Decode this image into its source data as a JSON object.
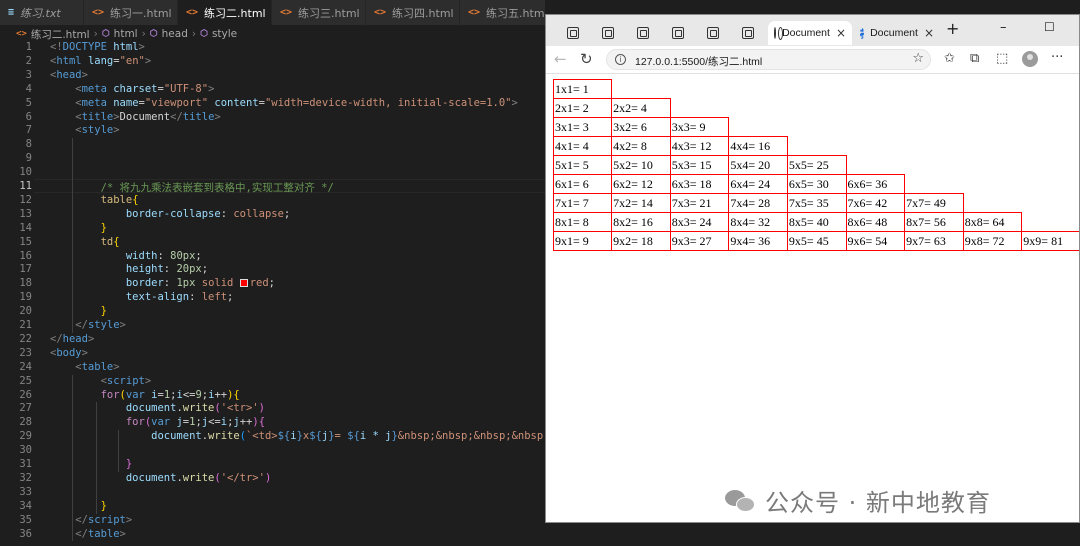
{
  "editor": {
    "tabs": [
      {
        "label": "练习.txt",
        "icon": "text-file-icon"
      },
      {
        "label": "练习一.html",
        "icon": "html-file-icon"
      },
      {
        "label": "练习二.html",
        "icon": "html-file-icon",
        "active": true
      },
      {
        "label": "练习三.html",
        "icon": "html-file-icon"
      },
      {
        "label": "练习四.html",
        "icon": "html-file-icon"
      },
      {
        "label": "练习五.html",
        "icon": "html-file-icon"
      }
    ],
    "close_glyph": "×",
    "breadcrumb": [
      "练习二.html",
      "html",
      "head",
      "style"
    ],
    "current_line": 11,
    "lines": [
      {
        "n": 1,
        "tokens": [
          {
            "t": "<!",
            "c": "#808080"
          },
          {
            "t": "DOCTYPE",
            "c": "#569cd6"
          },
          {
            "t": " html",
            "c": "#9cdcfe"
          },
          {
            "t": ">",
            "c": "#808080"
          }
        ]
      },
      {
        "n": 2,
        "tokens": [
          {
            "t": "<",
            "c": "#808080"
          },
          {
            "t": "html",
            "c": "#569cd6"
          },
          {
            "t": " lang",
            "c": "#9cdcfe"
          },
          {
            "t": "=",
            "c": "#d4d4d4"
          },
          {
            "t": "\"en\"",
            "c": "#ce9178"
          },
          {
            "t": ">",
            "c": "#808080"
          }
        ]
      },
      {
        "n": 3,
        "tokens": [
          {
            "t": "<",
            "c": "#808080"
          },
          {
            "t": "head",
            "c": "#569cd6"
          },
          {
            "t": ">",
            "c": "#808080"
          }
        ]
      },
      {
        "n": 4,
        "tokens": [
          {
            "t": "    <",
            "c": "#808080"
          },
          {
            "t": "meta",
            "c": "#569cd6"
          },
          {
            "t": " charset",
            "c": "#9cdcfe"
          },
          {
            "t": "=",
            "c": "#d4d4d4"
          },
          {
            "t": "\"UTF-8\"",
            "c": "#ce9178"
          },
          {
            "t": ">",
            "c": "#808080"
          }
        ]
      },
      {
        "n": 5,
        "tokens": [
          {
            "t": "    <",
            "c": "#808080"
          },
          {
            "t": "meta",
            "c": "#569cd6"
          },
          {
            "t": " name",
            "c": "#9cdcfe"
          },
          {
            "t": "=",
            "c": "#d4d4d4"
          },
          {
            "t": "\"viewport\"",
            "c": "#ce9178"
          },
          {
            "t": " content",
            "c": "#9cdcfe"
          },
          {
            "t": "=",
            "c": "#d4d4d4"
          },
          {
            "t": "\"width=device-width, initial-scale=1.0\"",
            "c": "#ce9178"
          },
          {
            "t": ">",
            "c": "#808080"
          }
        ]
      },
      {
        "n": 6,
        "tokens": [
          {
            "t": "    <",
            "c": "#808080"
          },
          {
            "t": "title",
            "c": "#569cd6"
          },
          {
            "t": ">",
            "c": "#808080"
          },
          {
            "t": "Document",
            "c": "#d4d4d4"
          },
          {
            "t": "</",
            "c": "#808080"
          },
          {
            "t": "title",
            "c": "#569cd6"
          },
          {
            "t": ">",
            "c": "#808080"
          }
        ]
      },
      {
        "n": 7,
        "tokens": [
          {
            "t": "    <",
            "c": "#808080"
          },
          {
            "t": "style",
            "c": "#569cd6"
          },
          {
            "t": ">",
            "c": "#808080"
          }
        ]
      },
      {
        "n": 8,
        "tokens": []
      },
      {
        "n": 9,
        "tokens": []
      },
      {
        "n": 10,
        "tokens": []
      },
      {
        "n": 11,
        "tokens": [
          {
            "t": "        /* 将九九乘法表嵌套到表格中,实现工整对齐 */",
            "c": "#6a9955"
          }
        ]
      },
      {
        "n": 12,
        "tokens": [
          {
            "t": "        table",
            "c": "#d7ba7d"
          },
          {
            "t": "{",
            "c": "#ffd700"
          }
        ]
      },
      {
        "n": 13,
        "tokens": [
          {
            "t": "            border-collapse",
            "c": "#9cdcfe"
          },
          {
            "t": ": ",
            "c": "#d4d4d4"
          },
          {
            "t": "collapse",
            "c": "#ce9178"
          },
          {
            "t": ";",
            "c": "#d4d4d4"
          }
        ]
      },
      {
        "n": 14,
        "tokens": [
          {
            "t": "        }",
            "c": "#ffd700"
          }
        ]
      },
      {
        "n": 15,
        "tokens": [
          {
            "t": "        td",
            "c": "#d7ba7d"
          },
          {
            "t": "{",
            "c": "#ffd700"
          }
        ]
      },
      {
        "n": 16,
        "tokens": [
          {
            "t": "            width",
            "c": "#9cdcfe"
          },
          {
            "t": ": ",
            "c": "#d4d4d4"
          },
          {
            "t": "80px",
            "c": "#b5cea8"
          },
          {
            "t": ";",
            "c": "#d4d4d4"
          }
        ]
      },
      {
        "n": 17,
        "tokens": [
          {
            "t": "            height",
            "c": "#9cdcfe"
          },
          {
            "t": ": ",
            "c": "#d4d4d4"
          },
          {
            "t": "20px",
            "c": "#b5cea8"
          },
          {
            "t": ";",
            "c": "#d4d4d4"
          }
        ]
      },
      {
        "n": 18,
        "tokens": [
          {
            "t": "            border",
            "c": "#9cdcfe"
          },
          {
            "t": ": ",
            "c": "#d4d4d4"
          },
          {
            "t": "1px",
            "c": "#b5cea8"
          },
          {
            "t": " solid ",
            "c": "#ce9178"
          },
          {
            "t": "SWATCH",
            "c": "#ff0000"
          },
          {
            "t": "red",
            "c": "#ce9178"
          },
          {
            "t": ";",
            "c": "#d4d4d4"
          }
        ]
      },
      {
        "n": 19,
        "tokens": [
          {
            "t": "            text-align",
            "c": "#9cdcfe"
          },
          {
            "t": ": ",
            "c": "#d4d4d4"
          },
          {
            "t": "left",
            "c": "#ce9178"
          },
          {
            "t": ";",
            "c": "#d4d4d4"
          }
        ]
      },
      {
        "n": 20,
        "tokens": [
          {
            "t": "        }",
            "c": "#ffd700"
          }
        ]
      },
      {
        "n": 21,
        "tokens": [
          {
            "t": "    </",
            "c": "#808080"
          },
          {
            "t": "style",
            "c": "#569cd6"
          },
          {
            "t": ">",
            "c": "#808080"
          }
        ]
      },
      {
        "n": 22,
        "tokens": [
          {
            "t": "</",
            "c": "#808080"
          },
          {
            "t": "head",
            "c": "#569cd6"
          },
          {
            "t": ">",
            "c": "#808080"
          }
        ]
      },
      {
        "n": 23,
        "tokens": [
          {
            "t": "<",
            "c": "#808080"
          },
          {
            "t": "body",
            "c": "#569cd6"
          },
          {
            "t": ">",
            "c": "#808080"
          }
        ]
      },
      {
        "n": 24,
        "tokens": [
          {
            "t": "    <",
            "c": "#808080"
          },
          {
            "t": "table",
            "c": "#569cd6"
          },
          {
            "t": ">",
            "c": "#808080"
          }
        ]
      },
      {
        "n": 25,
        "tokens": [
          {
            "t": "        <",
            "c": "#808080"
          },
          {
            "t": "script",
            "c": "#569cd6"
          },
          {
            "t": ">",
            "c": "#808080"
          }
        ]
      },
      {
        "n": 26,
        "tokens": [
          {
            "t": "        for",
            "c": "#c586c0"
          },
          {
            "t": "(",
            "c": "#ffd700"
          },
          {
            "t": "var",
            "c": "#569cd6"
          },
          {
            "t": " i",
            "c": "#9cdcfe"
          },
          {
            "t": "=",
            "c": "#d4d4d4"
          },
          {
            "t": "1",
            "c": "#b5cea8"
          },
          {
            "t": ";",
            "c": "#d4d4d4"
          },
          {
            "t": "i",
            "c": "#9cdcfe"
          },
          {
            "t": "<=",
            "c": "#d4d4d4"
          },
          {
            "t": "9",
            "c": "#b5cea8"
          },
          {
            "t": ";",
            "c": "#d4d4d4"
          },
          {
            "t": "i",
            "c": "#9cdcfe"
          },
          {
            "t": "++",
            "c": "#d4d4d4"
          },
          {
            "t": "){",
            "c": "#ffd700"
          }
        ]
      },
      {
        "n": 27,
        "tokens": [
          {
            "t": "            document",
            "c": "#9cdcfe"
          },
          {
            "t": ".",
            "c": "#d4d4d4"
          },
          {
            "t": "write",
            "c": "#dcdcaa"
          },
          {
            "t": "(",
            "c": "#da70d6"
          },
          {
            "t": "'<tr>'",
            "c": "#ce9178"
          },
          {
            "t": ")",
            "c": "#da70d6"
          }
        ]
      },
      {
        "n": 28,
        "tokens": [
          {
            "t": "            for",
            "c": "#c586c0"
          },
          {
            "t": "(",
            "c": "#da70d6"
          },
          {
            "t": "var",
            "c": "#569cd6"
          },
          {
            "t": " j",
            "c": "#9cdcfe"
          },
          {
            "t": "=",
            "c": "#d4d4d4"
          },
          {
            "t": "1",
            "c": "#b5cea8"
          },
          {
            "t": ";",
            "c": "#d4d4d4"
          },
          {
            "t": "j",
            "c": "#9cdcfe"
          },
          {
            "t": "<=",
            "c": "#d4d4d4"
          },
          {
            "t": "i",
            "c": "#9cdcfe"
          },
          {
            "t": ";",
            "c": "#d4d4d4"
          },
          {
            "t": "j",
            "c": "#9cdcfe"
          },
          {
            "t": "++",
            "c": "#d4d4d4"
          },
          {
            "t": "){",
            "c": "#da70d6"
          }
        ]
      },
      {
        "n": 29,
        "tokens": [
          {
            "t": "                document",
            "c": "#9cdcfe"
          },
          {
            "t": ".",
            "c": "#d4d4d4"
          },
          {
            "t": "write",
            "c": "#dcdcaa"
          },
          {
            "t": "(",
            "c": "#179fff"
          },
          {
            "t": "`<td>",
            "c": "#ce9178"
          },
          {
            "t": "${",
            "c": "#569cd6"
          },
          {
            "t": "i",
            "c": "#9cdcfe"
          },
          {
            "t": "}",
            "c": "#569cd6"
          },
          {
            "t": "x",
            "c": "#ce9178"
          },
          {
            "t": "${",
            "c": "#569cd6"
          },
          {
            "t": "j",
            "c": "#9cdcfe"
          },
          {
            "t": "}",
            "c": "#569cd6"
          },
          {
            "t": "= ",
            "c": "#ce9178"
          },
          {
            "t": "${",
            "c": "#569cd6"
          },
          {
            "t": "i * j",
            "c": "#9cdcfe"
          },
          {
            "t": "}",
            "c": "#569cd6"
          },
          {
            "t": "&nbsp;&nbsp;&nbsp;&nbsp;</td>`",
            "c": "#ce9178"
          },
          {
            "t": ")",
            "c": "#179fff"
          }
        ]
      },
      {
        "n": 30,
        "tokens": []
      },
      {
        "n": 31,
        "tokens": [
          {
            "t": "            }",
            "c": "#da70d6"
          }
        ]
      },
      {
        "n": 32,
        "tokens": [
          {
            "t": "            document",
            "c": "#9cdcfe"
          },
          {
            "t": ".",
            "c": "#d4d4d4"
          },
          {
            "t": "write",
            "c": "#dcdcaa"
          },
          {
            "t": "(",
            "c": "#da70d6"
          },
          {
            "t": "'</tr>'",
            "c": "#ce9178"
          },
          {
            "t": ")",
            "c": "#da70d6"
          }
        ]
      },
      {
        "n": 33,
        "tokens": []
      },
      {
        "n": 34,
        "tokens": [
          {
            "t": "        }",
            "c": "#ffd700"
          }
        ]
      },
      {
        "n": 35,
        "tokens": [
          {
            "t": "    </",
            "c": "#808080"
          },
          {
            "t": "script",
            "c": "#569cd6"
          },
          {
            "t": ">",
            "c": "#808080"
          }
        ]
      },
      {
        "n": 36,
        "tokens": [
          {
            "t": "    </",
            "c": "#808080"
          },
          {
            "t": "table",
            "c": "#569cd6"
          },
          {
            "t": ">",
            "c": "#808080"
          }
        ]
      }
    ]
  },
  "browser": {
    "tabs": [
      {
        "label": "Document",
        "active": true
      },
      {
        "label": "Document",
        "loading": true
      }
    ],
    "tab_close": "×",
    "new_tab": "+",
    "window_controls": {
      "minimize": "–",
      "maximize": "☐"
    },
    "url": "127.0.0.1:5500/练习二.html",
    "more_menu": "···",
    "multiplication_table": [
      [
        "1x1= 1"
      ],
      [
        "2x1= 2",
        "2x2= 4"
      ],
      [
        "3x1= 3",
        "3x2= 6",
        "3x3= 9"
      ],
      [
        "4x1= 4",
        "4x2= 8",
        "4x3= 12",
        "4x4= 16"
      ],
      [
        "5x1= 5",
        "5x2= 10",
        "5x3= 15",
        "5x4= 20",
        "5x5= 25"
      ],
      [
        "6x1= 6",
        "6x2= 12",
        "6x3= 18",
        "6x4= 24",
        "6x5= 30",
        "6x6= 36"
      ],
      [
        "7x1= 7",
        "7x2= 14",
        "7x3= 21",
        "7x4= 28",
        "7x5= 35",
        "7x6= 42",
        "7x7= 49"
      ],
      [
        "8x1= 8",
        "8x2= 16",
        "8x3= 24",
        "8x4= 32",
        "8x5= 40",
        "8x6= 48",
        "8x7= 56",
        "8x8= 64"
      ],
      [
        "9x1= 9",
        "9x2= 18",
        "9x3= 27",
        "9x4= 36",
        "9x5= 45",
        "9x6= 54",
        "9x7= 63",
        "9x8= 72",
        "9x9= 81"
      ]
    ],
    "table_border_color": "#ff0000"
  },
  "watermark": {
    "text": "公众号 · 新中地教育"
  }
}
